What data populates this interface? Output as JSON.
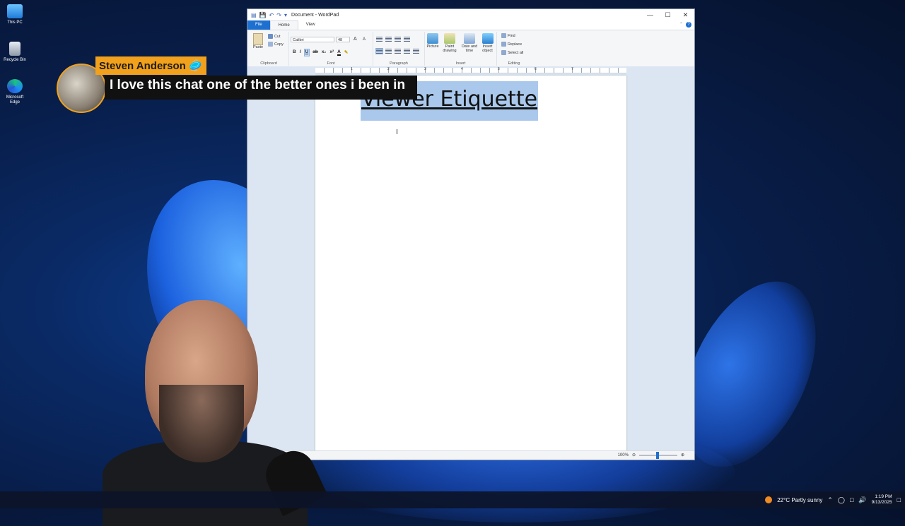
{
  "desktop": {
    "icons": [
      {
        "label": "This PC",
        "icon": "this-pc-icon"
      },
      {
        "label": "Recycle Bin",
        "icon": "recycle-bin-icon"
      },
      {
        "label": "Microsoft Edge",
        "icon": "edge-icon"
      }
    ]
  },
  "chat": {
    "username": "Steven Anderson",
    "badge": "🥏",
    "message": "I love this chat one of the better ones i been in",
    "accent": "#f2a11c"
  },
  "wordpad": {
    "title": "Document - WordPad",
    "tabs": [
      "File",
      "Home",
      "View"
    ],
    "active_tab": "Home",
    "clipboard": {
      "paste": "Paste",
      "cut": "Cut",
      "copy": "Copy",
      "group": "Clipboard"
    },
    "font": {
      "family": "Calibri",
      "size": "48",
      "group": "Font"
    },
    "paragraph": {
      "group": "Paragraph"
    },
    "insert": {
      "picture": "Picture",
      "paint": "Paint drawing",
      "datetime": "Date and time",
      "object": "Insert object",
      "group": "Insert"
    },
    "editing": {
      "find": "Find",
      "replace": "Replace",
      "select_all": "Select all",
      "group": "Editing"
    },
    "document": {
      "heading": "Viewer Etiquette"
    },
    "ruler": [
      "1",
      "2",
      "3",
      "4",
      "5",
      "6",
      "7"
    ],
    "status": {
      "zoom": "100%"
    }
  },
  "taskbar": {
    "weather": "22°C  Partly sunny",
    "time": "1:19 PM",
    "date": "9/13/2025"
  },
  "colors": {
    "accent": "#1d6fd0",
    "selection": "#a9c8ec"
  }
}
